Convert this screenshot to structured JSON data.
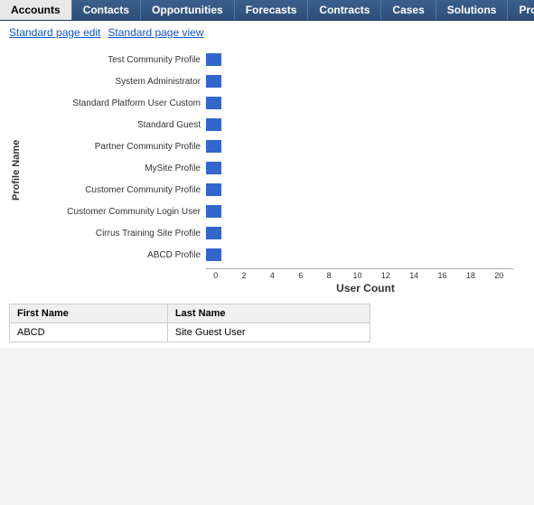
{
  "nav": {
    "items": [
      {
        "label": "Accounts",
        "active": true
      },
      {
        "label": "Contacts",
        "active": false
      },
      {
        "label": "Opportunities",
        "active": false
      },
      {
        "label": "Forecasts",
        "active": false
      },
      {
        "label": "Contracts",
        "active": false
      },
      {
        "label": "Cases",
        "active": false
      },
      {
        "label": "Solutions",
        "active": false
      },
      {
        "label": "Prod...",
        "active": false
      }
    ]
  },
  "page_links": {
    "standard_edit": "Standard page edit",
    "standard_view": "Standard page view"
  },
  "chart": {
    "y_axis_label": "Profile Name",
    "x_axis_label": "User Count",
    "max_value": 20,
    "x_ticks": [
      "0",
      "2",
      "4",
      "6",
      "8",
      "10",
      "12",
      "14",
      "16",
      "18",
      "20"
    ],
    "bars": [
      {
        "label": "Test Community Profile",
        "value": 1
      },
      {
        "label": "System Administrator",
        "value": 1
      },
      {
        "label": "Standard Platform User Custom",
        "value": 1
      },
      {
        "label": "Standard Guest",
        "value": 1
      },
      {
        "label": "Partner Community Profile",
        "value": 1
      },
      {
        "label": "MySite Profile",
        "value": 1
      },
      {
        "label": "Customer Community Profile",
        "value": 1
      },
      {
        "label": "Customer Community Login User",
        "value": 1
      },
      {
        "label": "Cirrus Training Site Profile",
        "value": 1
      },
      {
        "label": "ABCD Profile",
        "value": 1
      }
    ]
  },
  "table": {
    "columns": [
      "First Name",
      "Last Name"
    ],
    "rows": [
      {
        "first_name": "ABCD",
        "last_name": "Site Guest User"
      }
    ]
  }
}
